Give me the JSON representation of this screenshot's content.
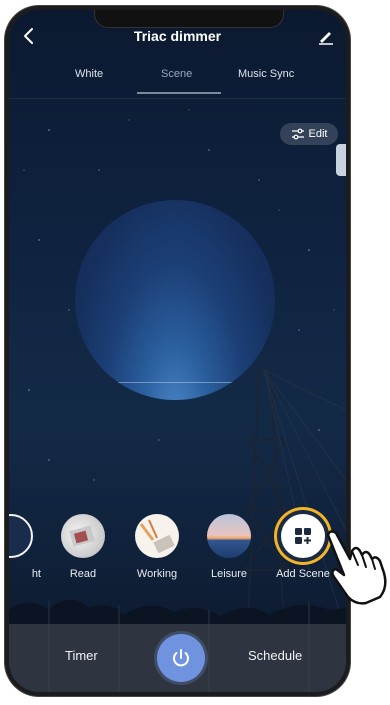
{
  "header": {
    "title": "Triac dimmer"
  },
  "tabs": [
    {
      "label": "White"
    },
    {
      "label": "Scene"
    },
    {
      "label": "Music Sync"
    }
  ],
  "edit_button": {
    "label": "Edit"
  },
  "scenes": [
    {
      "label": "ht"
    },
    {
      "label": "Read"
    },
    {
      "label": "Working"
    },
    {
      "label": "Leisure"
    },
    {
      "label": "Add Scene"
    }
  ],
  "bottom_bar": {
    "timer_label": "Timer",
    "schedule_label": "Schedule"
  },
  "icons": {
    "back": "chevron-left-icon",
    "header_action": "pencil-icon",
    "edit": "sliders-icon",
    "add_scene": "grid-plus-icon",
    "power": "power-icon",
    "pointer": "hand-pointer-icon"
  },
  "colors": {
    "accent": "#6f93de",
    "highlight_ring": "#f2b428",
    "background": "#0f2340"
  }
}
